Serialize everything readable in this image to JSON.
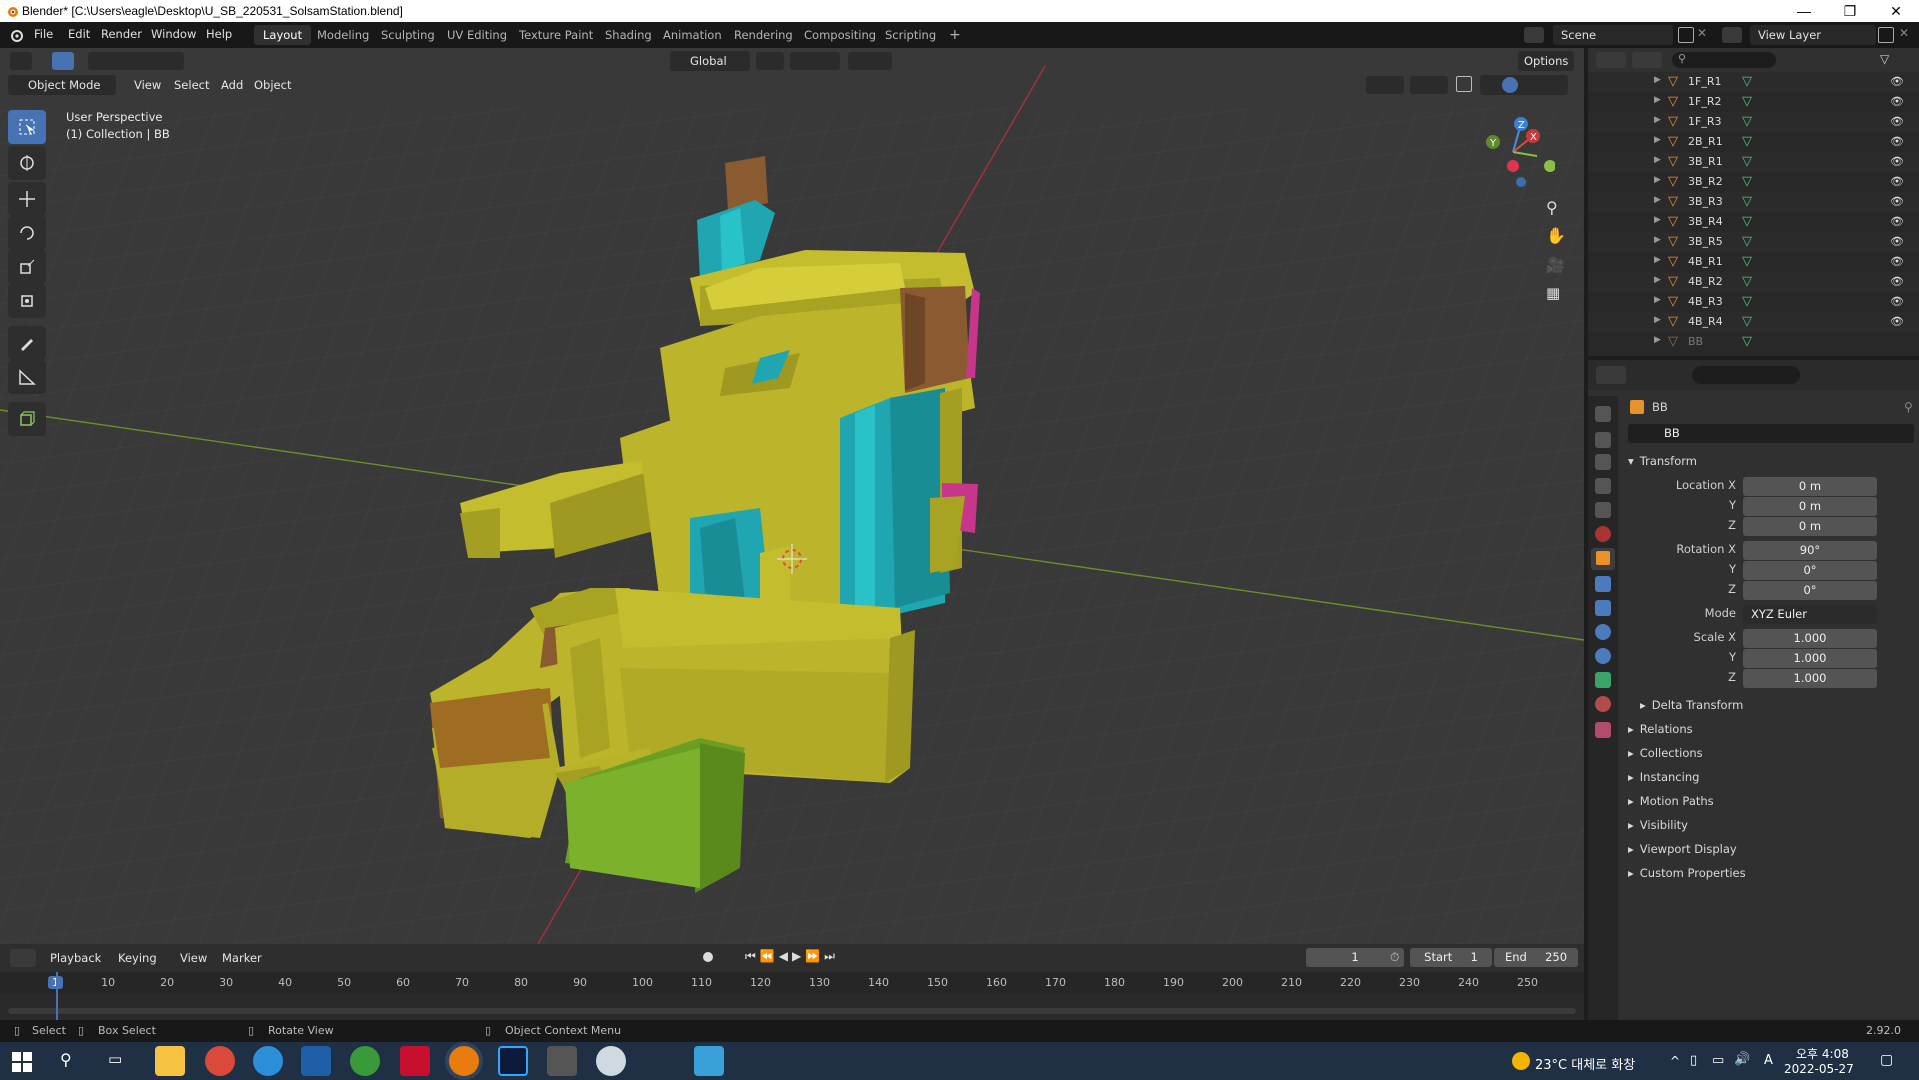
{
  "window": {
    "title": "Blender* [C:\\Users\\eagle\\Desktop\\U_SB_220531_SolsamStation.blend]",
    "minimize": "—",
    "maximize": "❐",
    "close": "✕"
  },
  "menubar": {
    "items": [
      "File",
      "Edit",
      "Render",
      "Window",
      "Help"
    ],
    "workspaces": [
      "Layout",
      "Modeling",
      "Sculpting",
      "UV Editing",
      "Texture Paint",
      "Shading",
      "Animation",
      "Rendering",
      "Compositing",
      "Scripting",
      "+"
    ],
    "active_workspace": "Layout",
    "scene": "Scene",
    "view_layer": "View Layer"
  },
  "viewport": {
    "mode": "Object Mode",
    "menus": [
      "View",
      "Select",
      "Add",
      "Object"
    ],
    "transform_orientation": "Global",
    "options": "Options",
    "overlay_line1": "User Perspective",
    "overlay_line2": "(1) Collection | BB",
    "gizmo_x": "X",
    "gizmo_y": "Y",
    "gizmo_z": "Z"
  },
  "outliner": {
    "items": [
      "1F_R1",
      "1F_R2",
      "1F_R3",
      "2B_R1",
      "3B_R1",
      "3B_R2",
      "3B_R3",
      "3B_R4",
      "3B_R5",
      "4B_R1",
      "4B_R2",
      "4B_R3",
      "4B_R4",
      "BB"
    ]
  },
  "properties": {
    "object_name": "BB",
    "data_name": "BB",
    "transform_header": "Transform",
    "location_label": "Location X",
    "rotation_label": "Rotation X",
    "scale_label": "Scale X",
    "y_label": "Y",
    "z_label": "Z",
    "location": [
      "0 m",
      "0 m",
      "0 m"
    ],
    "rotation": [
      "90°",
      "0°",
      "0°"
    ],
    "mode_label": "Mode",
    "mode_value": "XYZ Euler",
    "scale": [
      "1.000",
      "1.000",
      "1.000"
    ],
    "sections": [
      "Delta Transform",
      "Relations",
      "Collections",
      "Instancing",
      "Motion Paths",
      "Visibility",
      "Viewport Display",
      "Custom Properties"
    ]
  },
  "timeline": {
    "menus": [
      "Playback",
      "Keying",
      "View",
      "Marker"
    ],
    "current_frame": "1",
    "start_label": "Start",
    "start": "1",
    "end_label": "End",
    "end": "250",
    "ruler": [
      "1",
      "10",
      "20",
      "30",
      "40",
      "50",
      "60",
      "70",
      "80",
      "90",
      "100",
      "110",
      "120",
      "130",
      "140",
      "150",
      "160",
      "170",
      "180",
      "190",
      "200",
      "210",
      "220",
      "230",
      "240",
      "250"
    ]
  },
  "statusbar": {
    "select": "Select",
    "box_select": "Box Select",
    "rotate_view": "Rotate View",
    "context_menu": "Object Context Menu",
    "version": "2.92.0"
  },
  "taskbar": {
    "weather": "23°C 대체로 화창",
    "ime": "A",
    "time": "오후 4:08",
    "date": "2022-05-27"
  },
  "colors": {
    "yellow_block": "#b9b32a",
    "cyan_block": "#1fa6b0",
    "brown_block": "#8a5a30",
    "green_block": "#6b9e23",
    "accent": "#4772b3"
  }
}
